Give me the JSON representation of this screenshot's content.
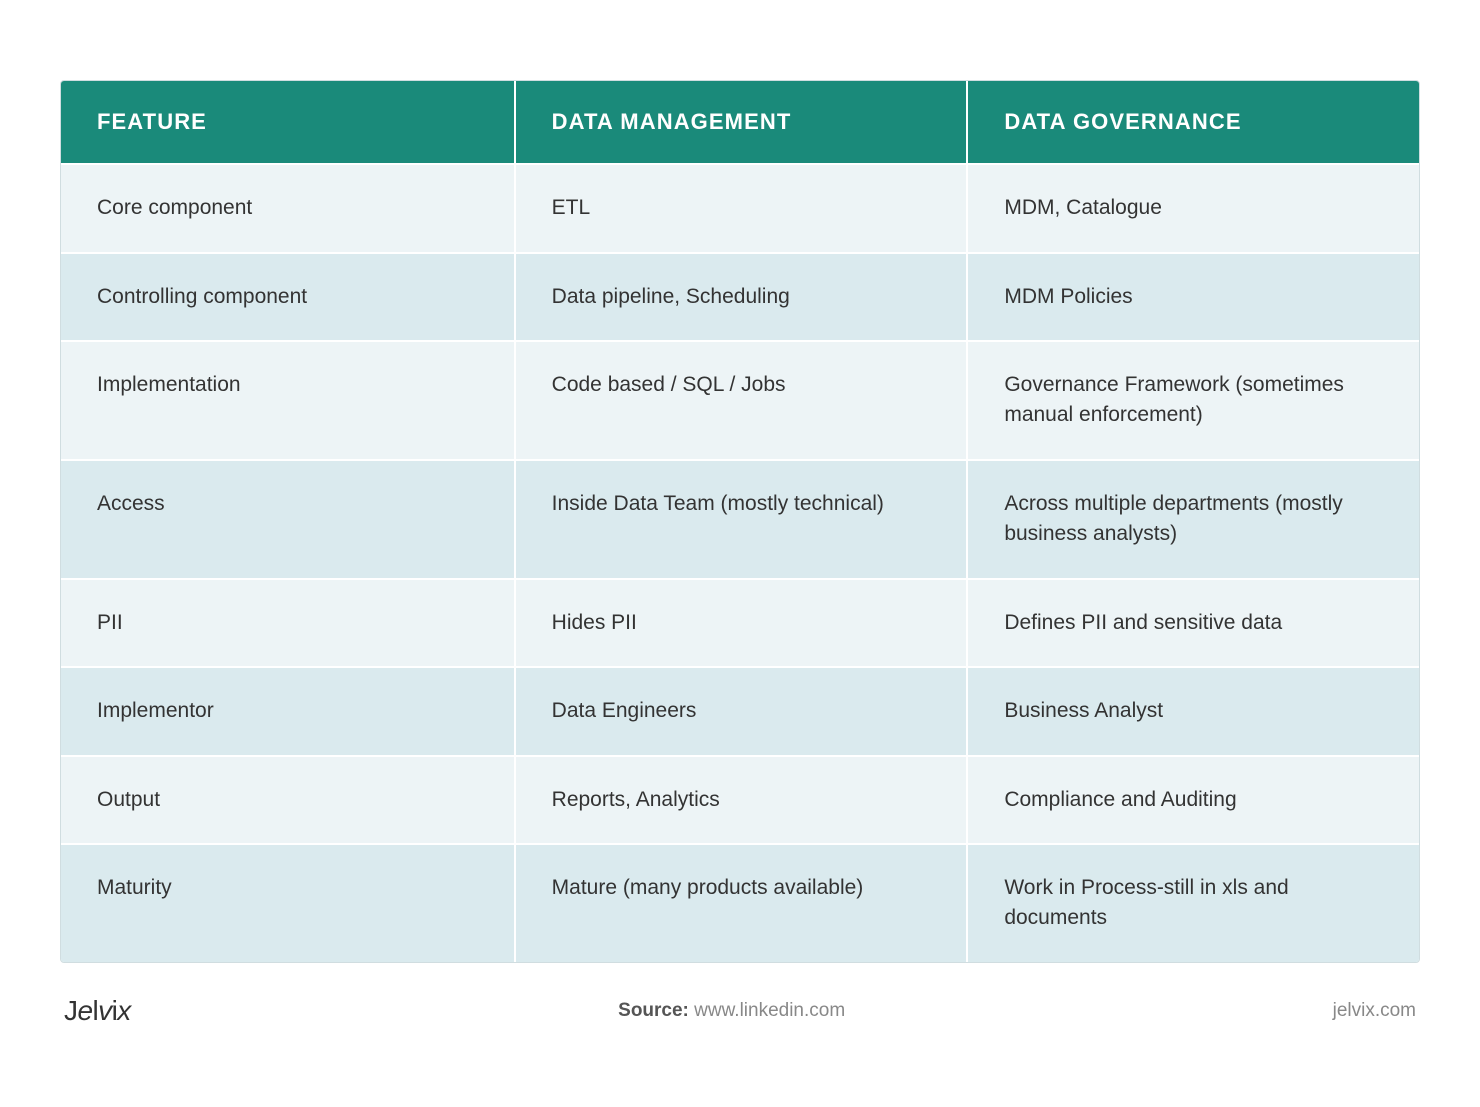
{
  "header": {
    "col1": "FEATURE",
    "col2": "DATA MANAGEMENT",
    "col3": "DATA GOVERNANCE"
  },
  "rows": [
    {
      "feature": "Core component",
      "data_management": "ETL",
      "data_governance": "MDM, Catalogue"
    },
    {
      "feature": "Controlling component",
      "data_management": "Data pipeline, Scheduling",
      "data_governance": "MDM Policies"
    },
    {
      "feature": "Implementation",
      "data_management": "Code based / SQL / Jobs",
      "data_governance": "Governance Framework (sometimes manual enforcement)"
    },
    {
      "feature": "Access",
      "data_management": "Inside Data Team (mostly technical)",
      "data_governance": "Across multiple departments (mostly business analysts)"
    },
    {
      "feature": "PII",
      "data_management": "Hides PII",
      "data_governance": "Defines PII and sensitive data"
    },
    {
      "feature": "Implementor",
      "data_management": "Data Engineers",
      "data_governance": "Business Analyst"
    },
    {
      "feature": "Output",
      "data_management": "Reports, Analytics",
      "data_governance": "Compliance and Auditing"
    },
    {
      "feature": "Maturity",
      "data_management": "Mature (many products available)",
      "data_governance": "Work in Process-still in xls and documents"
    }
  ],
  "footer": {
    "brand": "Jelvix",
    "source_label": "Source:",
    "source_url": "www.linkedin.com",
    "website": "jelvix.com"
  }
}
